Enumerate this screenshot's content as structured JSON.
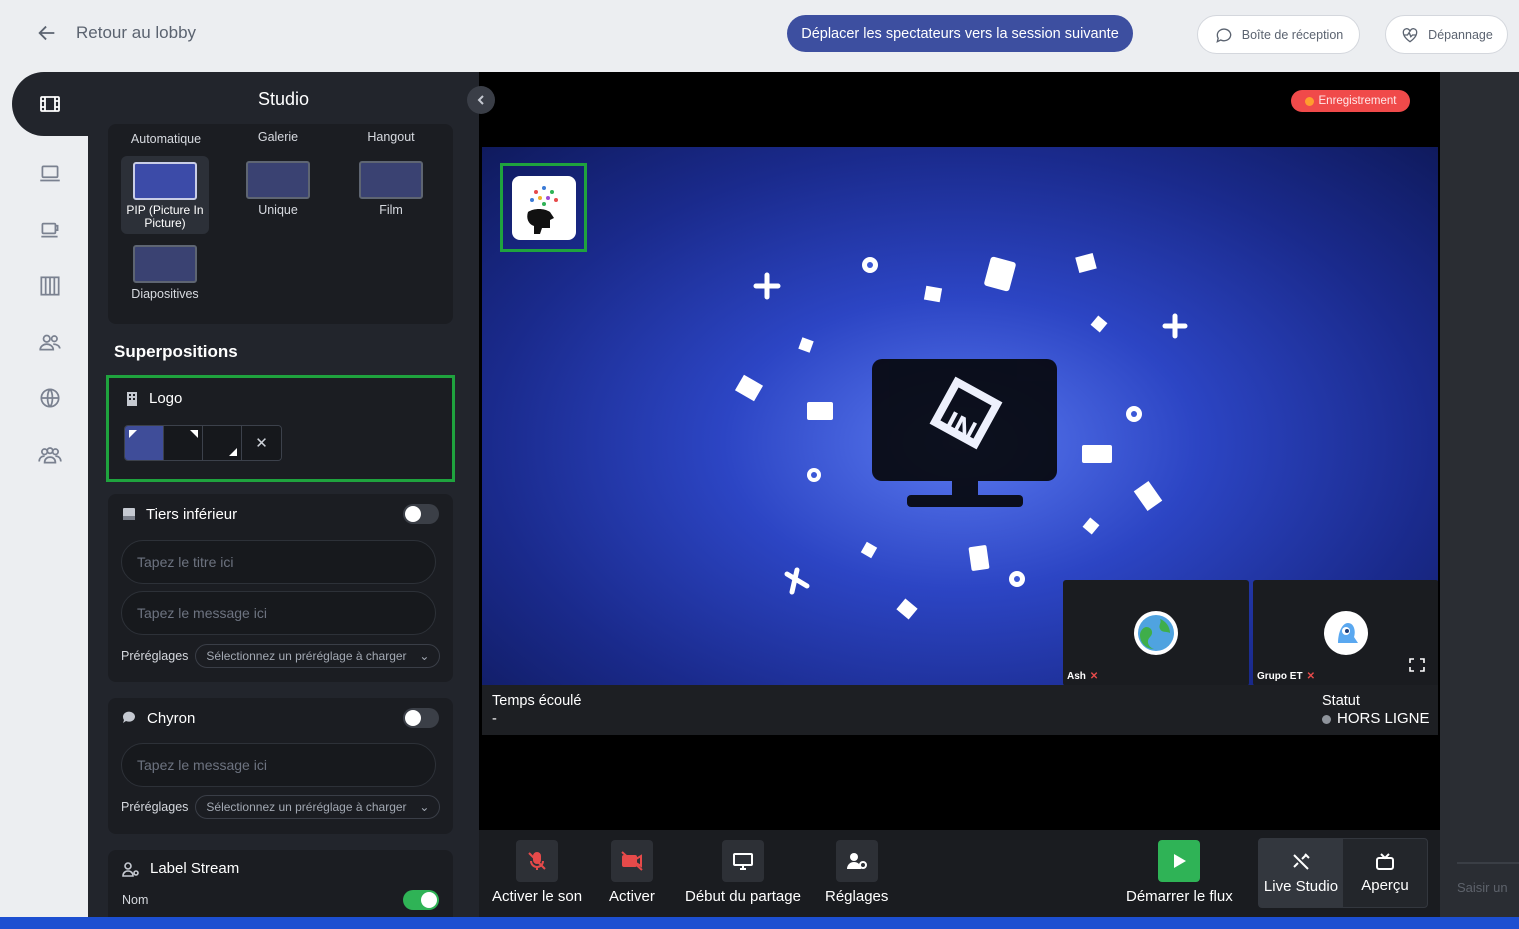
{
  "topbar": {
    "back_label": "Retour au lobby",
    "move_button": "Déplacer les spectateurs vers la session suivante",
    "inbox_button": "Boîte de réception",
    "help_button": "Dépannage"
  },
  "panel": {
    "title": "Studio",
    "layouts": [
      {
        "label": "Automatique"
      },
      {
        "label": "Galerie"
      },
      {
        "label": "Hangout"
      },
      {
        "label": "PIP (Picture In Picture)",
        "active": true
      },
      {
        "label": "Unique"
      },
      {
        "label": "Film"
      },
      {
        "label": "Diapositives"
      }
    ],
    "overlays_title": "Superpositions",
    "logo": {
      "label": "Logo"
    },
    "lower_third": {
      "label": "Tiers inférieur",
      "enabled": false,
      "title_placeholder": "Tapez le titre ici",
      "message_placeholder": "Tapez le message ici",
      "presets_label": "Préréglages",
      "presets_select": "Sélectionnez un préréglage à charger"
    },
    "chyron": {
      "label": "Chyron",
      "enabled": false,
      "message_placeholder": "Tapez le message ici",
      "presets_label": "Préréglages",
      "presets_select": "Sélectionnez un préréglage à charger"
    },
    "label_stream": {
      "label": "Label Stream",
      "name_label": "Nom",
      "enabled": true
    }
  },
  "stage": {
    "recording_badge": "Enregistrement",
    "participants": [
      {
        "name": "Ash"
      },
      {
        "name": "Grupo ET"
      }
    ],
    "elapsed_label": "Temps écoulé",
    "elapsed_value": "-",
    "status_label": "Statut",
    "status_value": "HORS LIGNE"
  },
  "controls": {
    "mic": "Activer le son",
    "camera": "Activer",
    "share": "Début du partage",
    "settings": "Réglages",
    "start_stream": "Démarrer le flux",
    "live_studio": "Live Studio",
    "preview": "Aperçu"
  },
  "chat": {
    "placeholder": "Saisir un"
  },
  "colors": {
    "accent": "#3d4fa0",
    "panel_bg": "#22252c",
    "highlight": "#1fa33e",
    "recording": "#f04a4a",
    "toggle_on": "#2fb356"
  }
}
